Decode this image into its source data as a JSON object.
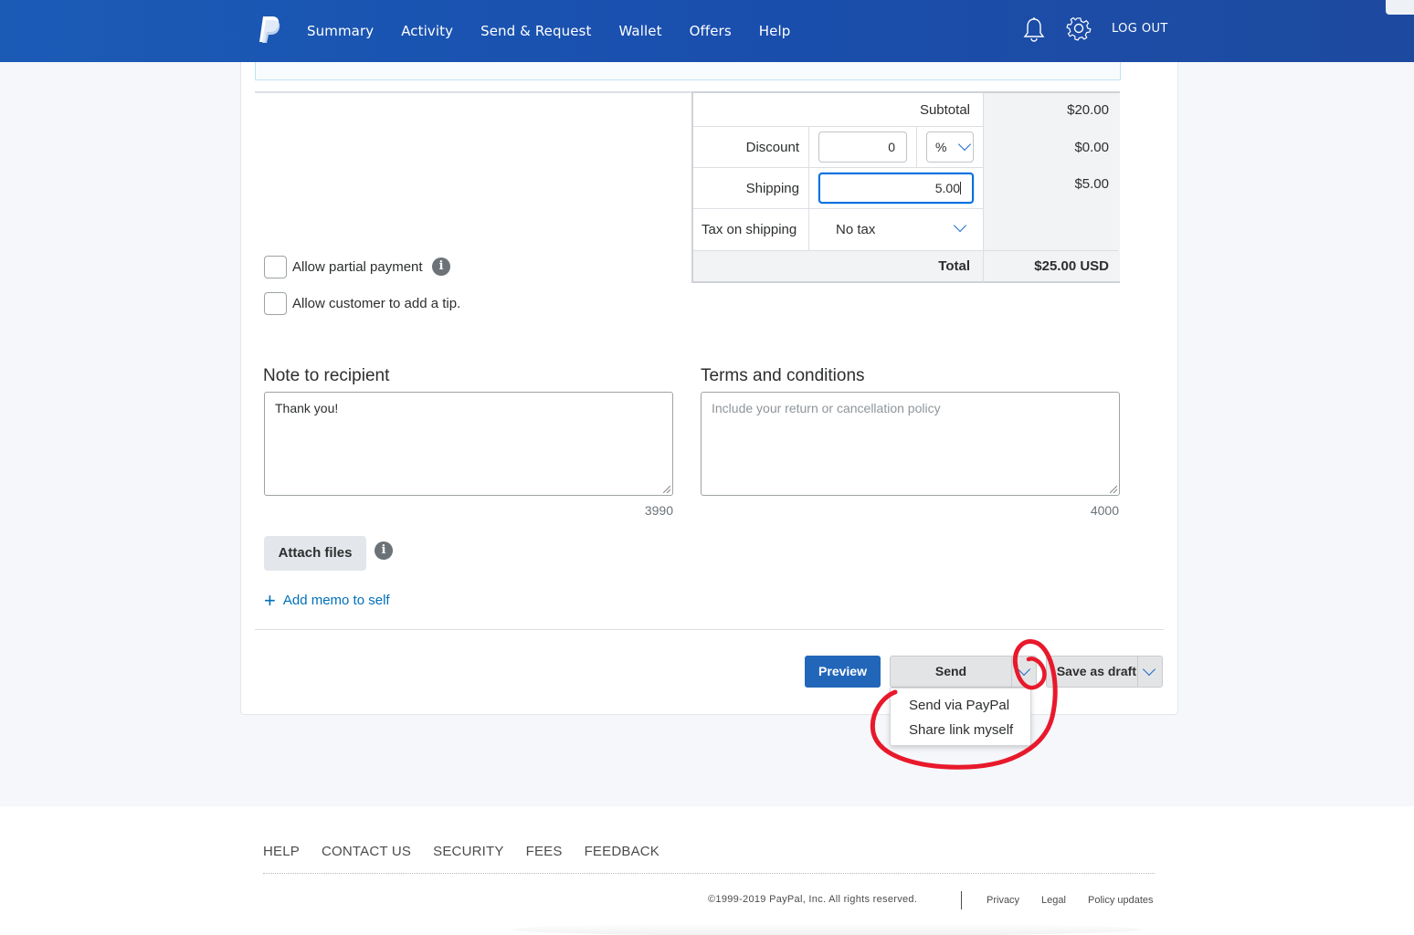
{
  "header": {
    "nav": [
      "Summary",
      "Activity",
      "Send & Request",
      "Wallet",
      "Offers",
      "Help"
    ],
    "logout": "LOG OUT",
    "brand_color": "#1b5bb6"
  },
  "totals": {
    "subtotal_label": "Subtotal",
    "subtotal_value": "$20.00",
    "discount_label": "Discount",
    "discount_input": "0",
    "discount_unit": "%",
    "discount_value": "$0.00",
    "shipping_label": "Shipping",
    "shipping_input": "5.00",
    "shipping_value": "$5.00",
    "tax_label": "Tax on shipping",
    "tax_select": "No tax",
    "total_label": "Total",
    "total_value": "$25.00 USD"
  },
  "options": {
    "partial_payment": "Allow partial payment",
    "tip": "Allow customer to add a tip."
  },
  "note": {
    "title": "Note to recipient",
    "value": "Thank you!",
    "counter": "3990"
  },
  "terms": {
    "title": "Terms and conditions",
    "placeholder": "Include your return or cancellation policy",
    "counter": "4000"
  },
  "attach_label": "Attach files",
  "memo_label": "Add memo to self",
  "actions": {
    "preview": "Preview",
    "send": "Send",
    "save_draft": "Save as draft"
  },
  "send_menu": [
    "Send via PayPal",
    "Share link myself"
  ],
  "footer": {
    "links": [
      "HELP",
      "CONTACT US",
      "SECURITY",
      "FEES",
      "FEEDBACK"
    ],
    "copyright": "©1999-2019 PayPal, Inc. All rights reserved.",
    "privacy": "Privacy",
    "legal": "Legal",
    "policy_updates": "Policy updates"
  },
  "annotation_color": "#e8192c"
}
